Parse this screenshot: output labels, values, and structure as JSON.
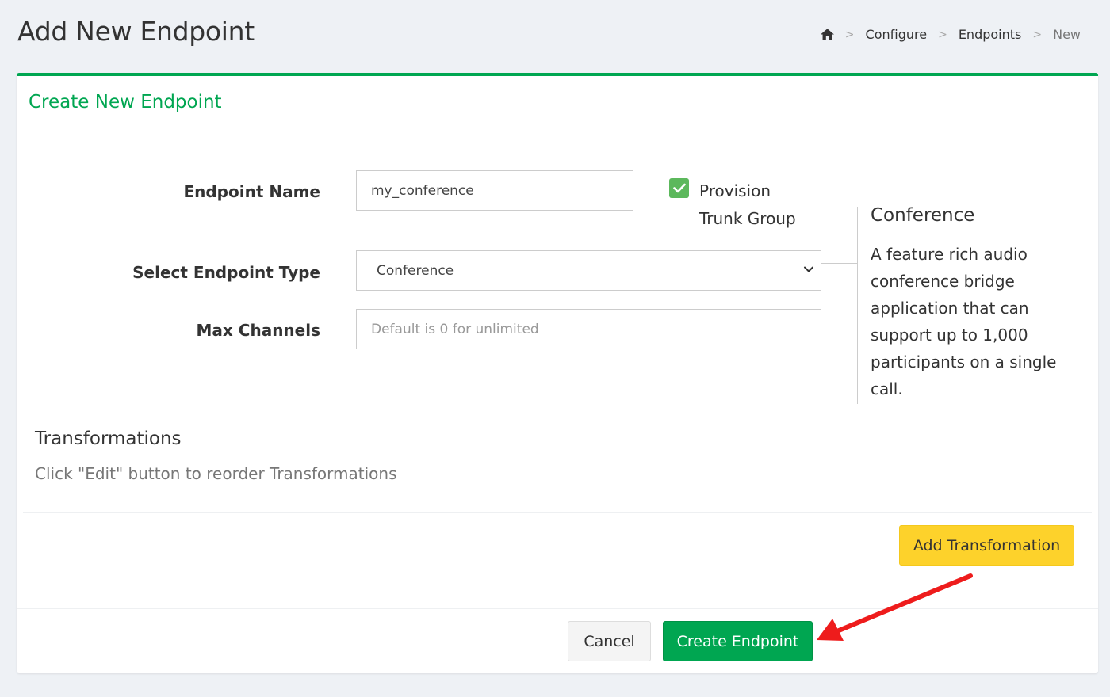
{
  "header": {
    "title": "Add New Endpoint",
    "breadcrumb": {
      "home_icon": "home-icon",
      "items": [
        "Configure",
        "Endpoints",
        "New"
      ],
      "separator": ">"
    }
  },
  "card": {
    "title": "Create New Endpoint",
    "form": {
      "endpoint_name_label": "Endpoint Name",
      "endpoint_name_value": "my_conference",
      "provision_label_line1": "Provision",
      "provision_label_line2": "Trunk Group",
      "provision_checked": true,
      "endpoint_type_label": "Select Endpoint Type",
      "endpoint_type_value": "Conference",
      "max_channels_label": "Max Channels",
      "max_channels_placeholder": "Default is 0 for unlimited"
    },
    "info": {
      "title": "Conference",
      "description": "A feature rich audio conference bridge application that can support up to 1,000 participants on a single call."
    },
    "transformations": {
      "title": "Transformations",
      "hint": "Click \"Edit\" button to reorder Transformations",
      "add_button": "Add Transformation"
    },
    "footer": {
      "cancel_button": "Cancel",
      "create_button": "Create Endpoint"
    }
  },
  "colors": {
    "brand_green": "#00a651",
    "add_yellow": "#fdd22b",
    "check_green": "#5cb85c",
    "annotation_red": "#ee1c1c"
  }
}
